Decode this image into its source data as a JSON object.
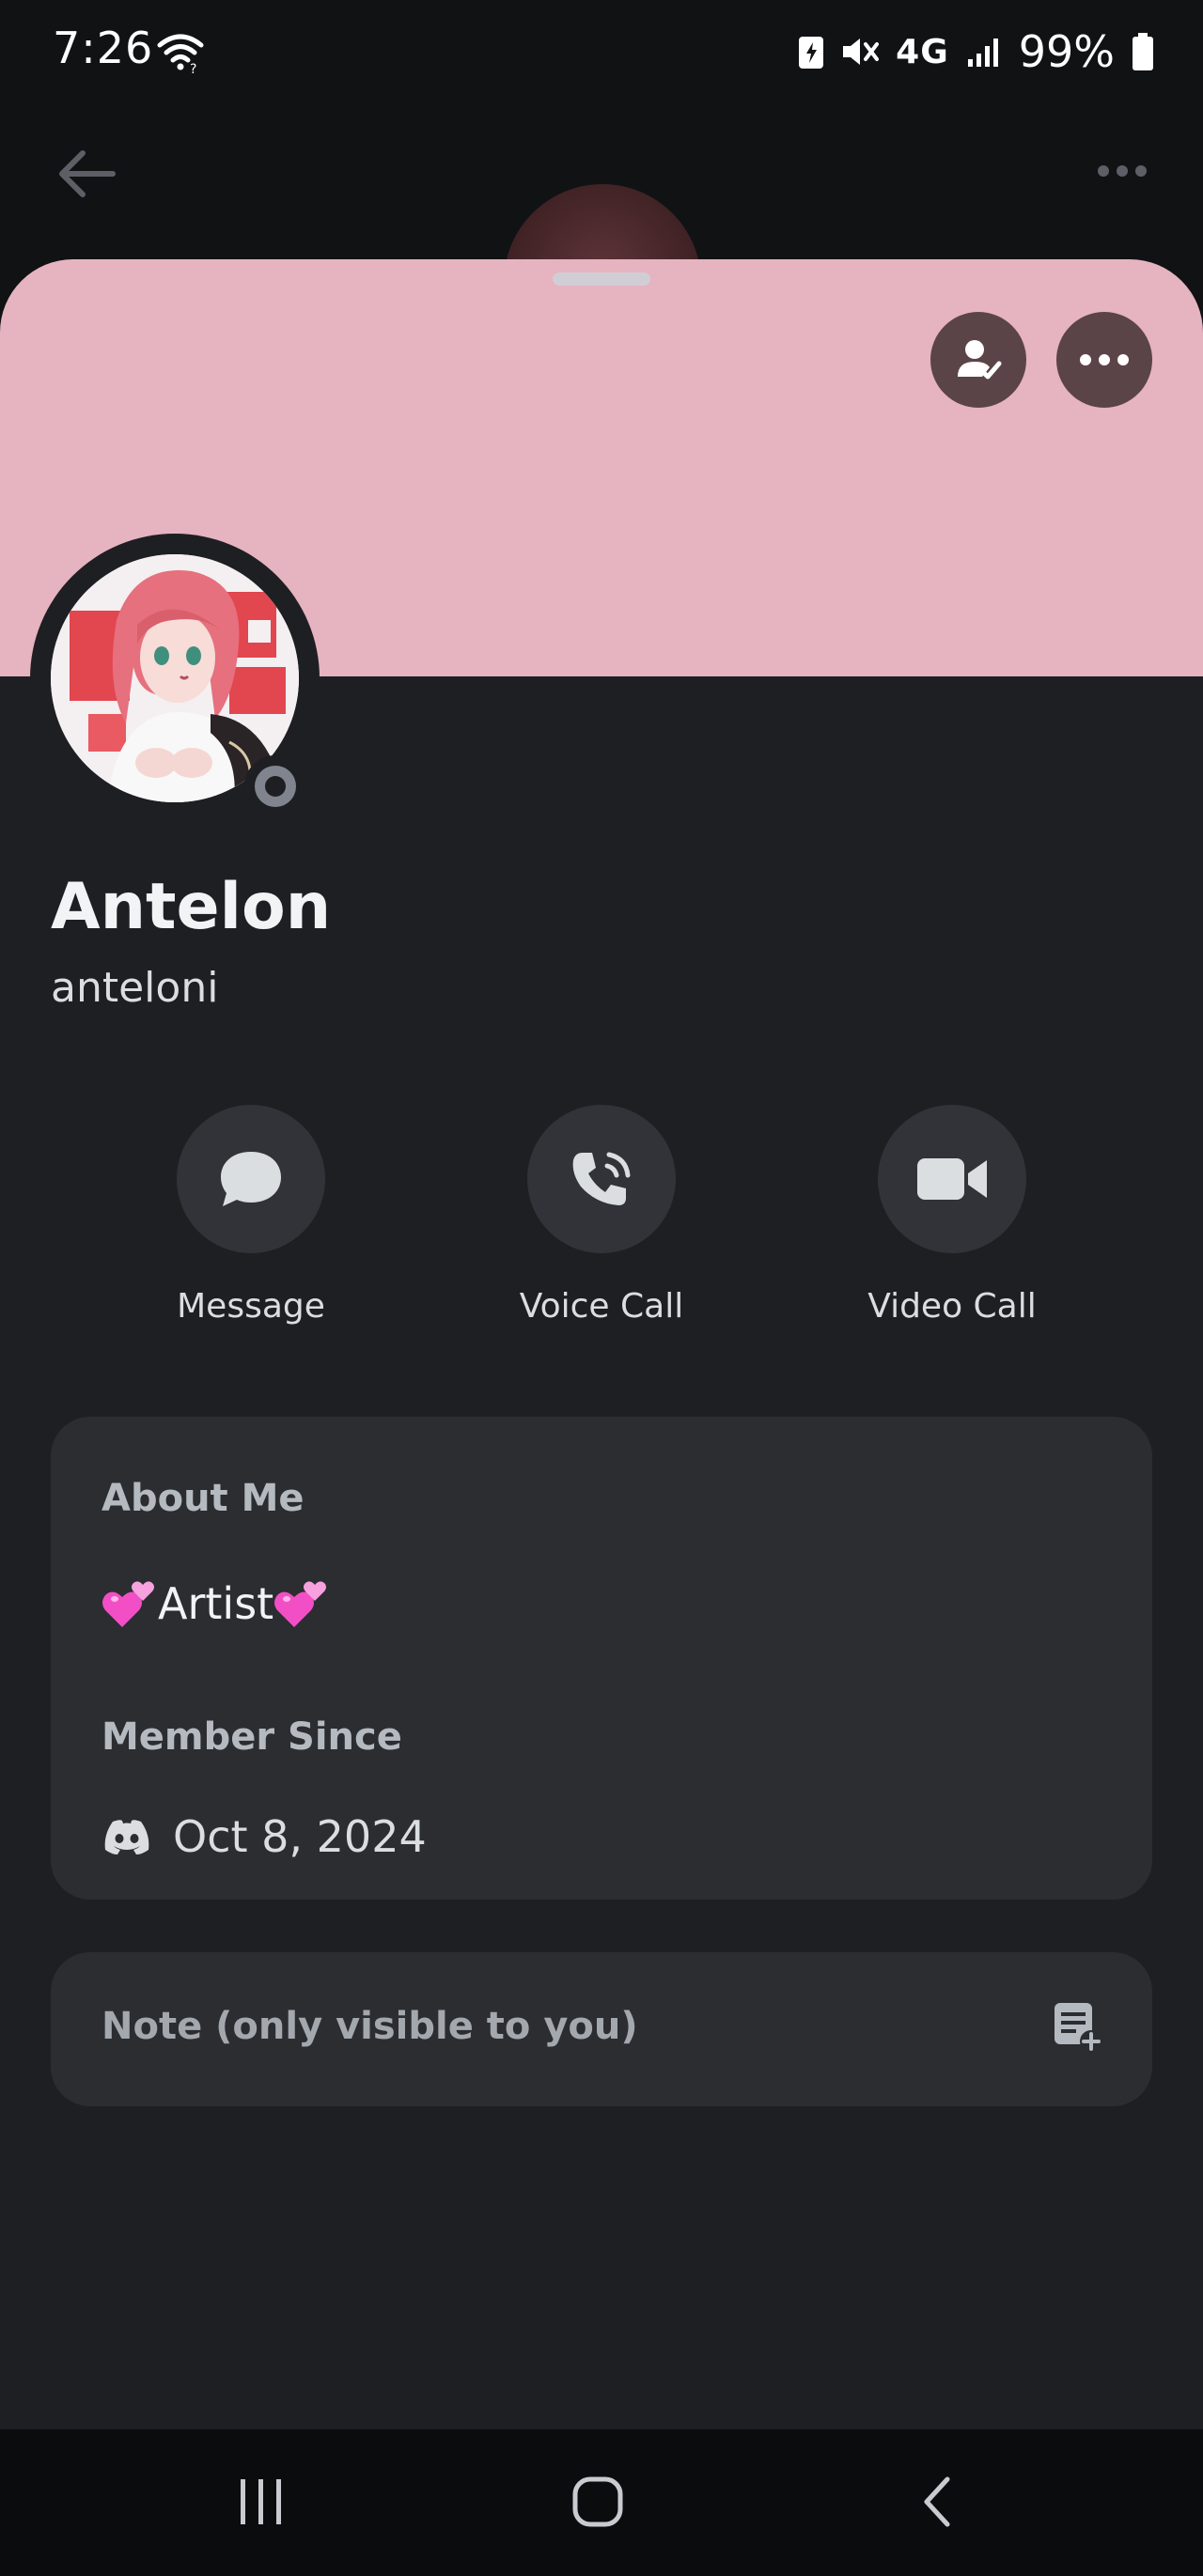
{
  "status_bar": {
    "time": "7:26",
    "network": "4G",
    "battery": "99%",
    "icons": [
      "wifi-icon",
      "data-saver-icon",
      "mute-icon",
      "signal-icon",
      "battery-icon"
    ]
  },
  "header": {
    "back_icon": "arrow-left-icon",
    "more_icon": "more-horizontal-icon"
  },
  "profile": {
    "banner_color": "#e6b3c0",
    "display_name": "Antelon",
    "username": "anteloni",
    "status": "offline",
    "top_actions": [
      "friend-check-icon",
      "more-horizontal-icon"
    ]
  },
  "actions": [
    {
      "label": "Message",
      "icon": "chat-bubble-icon"
    },
    {
      "label": "Voice Call",
      "icon": "phone-call-icon"
    },
    {
      "label": "Video Call",
      "icon": "video-camera-icon"
    }
  ],
  "about": {
    "heading": "About Me",
    "text": "Artist",
    "decoration": "two-hearts-emoji",
    "member_since_heading": "Member Since",
    "member_since_date": "Oct 8, 2024"
  },
  "note": {
    "placeholder": "Note (only visible to you)"
  },
  "colors": {
    "sheet_bg": "#1e1f22",
    "card_bg": "#2b2d31",
    "button_bg": "#313338",
    "accent_pink": "#e6b3c0"
  }
}
